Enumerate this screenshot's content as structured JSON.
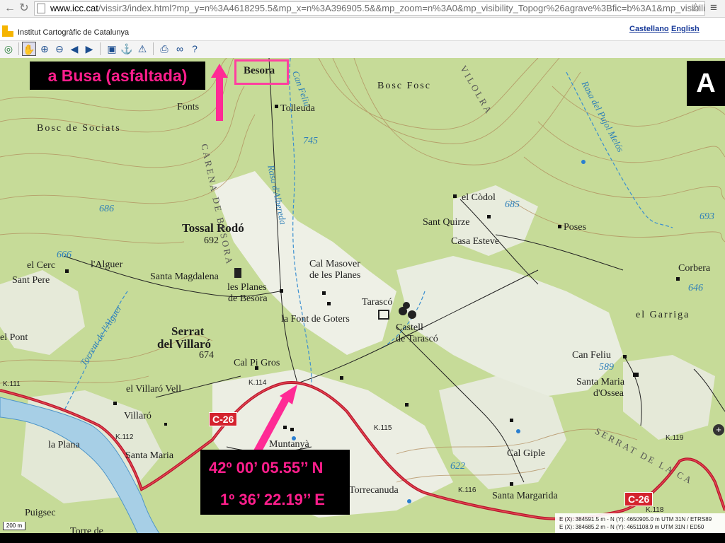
{
  "browser": {
    "url_host": "www.icc.cat",
    "url_path": "/vissir3/index.html?mp_y=n%3A4618295.5&mp_x=n%3A396905.5&&mp_zoom=n%3A0&mp_visibility_Topogr%26agrave%3Bfic=b%3A1&mp_visibility_Ort",
    "icons": [
      "back-icon",
      "reload-icon",
      "star-icon",
      "menu-icon"
    ]
  },
  "header": {
    "org_name": "Institut Cartogràfic de Catalunya",
    "lang_es": "Castellano",
    "lang_en": "English",
    "brand_color": "#f5b400"
  },
  "toolbar": {
    "tools": [
      "overview-icon",
      "pan-hand-icon",
      "zoom-in-icon",
      "zoom-out-icon",
      "previous-icon",
      "next-icon",
      "save-icon",
      "anchor-icon",
      "warning-icon",
      "print-icon",
      "link-icon",
      "help-icon"
    ]
  },
  "overlay": {
    "busa_label": "a Busa (asfaltada)",
    "coord_lat": "42º 00’ 05.55’’ N",
    "coord_lon": "1º 36’ 22.19’’ E",
    "letter": "A",
    "highlight_color": "#ff1e8c"
  },
  "map": {
    "places": {
      "besora": "Besora",
      "bosc_fosc": "Bosc Fosc",
      "fonts": "Fonts",
      "tolleuda": "Tolleuda",
      "bosc_sociats": "Bosc de Sociats",
      "el_codol": "el Còdol",
      "sant_quirze": "Sant Quirze",
      "casa_esteve": "Casa Esteve",
      "poses": "Poses",
      "tossal_rodo": "Tossal Rodó",
      "tossal_alt": "692",
      "el_cerc": "el Cerc",
      "alguer": "l'Alguer",
      "sant_pere": "Sant Pere",
      "santa_magdalena": "Santa Magdalena",
      "les_planes_1": "les Planes",
      "les_planes_2": "de Besora",
      "cal_masover_1": "Cal Masover",
      "cal_masover_2": "de les Planes",
      "tarasco": "Tarascó",
      "castell_1": "Castell",
      "castell_2": "de Tarascó",
      "font_goters": "la Font de Goters",
      "corbera": "Corbera",
      "el_garriga": "el Garriga",
      "serrat_1": "Serrat",
      "serrat_2": "del Villaró",
      "serrat_alt": "674",
      "el_pont": "el Pont",
      "cal_pi_gros": "Cal Pi Gros",
      "el_villaro_vell": "el Villaró Vell",
      "villaro": "Villaró",
      "can_feliu": "Can Feliu",
      "santa_maria_ossea_1": "Santa Maria",
      "santa_maria_ossea_2": "d'Ossea",
      "la_plana": "la Plana",
      "santa_maria": "Santa Maria",
      "muntanya": "Muntanyà",
      "cal_giple": "Cal Giple",
      "puigsec": "Puigsec",
      "torre_de": "Torre de",
      "torrecanuda": "Torrecanuda",
      "santa_margarida": "Santa Margarida"
    },
    "ridges": {
      "carena": "CARENA DE BESORA",
      "serrat_ca": "SERRAT DE LA CA",
      "vilolra": "VILOLRA"
    },
    "water": {
      "can_feliu": "Can Feliu",
      "rasa_albereda": "Rasa d'Albereda",
      "rasa_pujol": "Rasa del Pujol Melós",
      "torrent_alguer": "Torrent de l'Alguer"
    },
    "heights": {
      "h745": "745",
      "h686": "686",
      "h685": "685",
      "h693": "693",
      "h666": "666",
      "h646": "646",
      "h589": "589",
      "h622": "622"
    },
    "roads": {
      "c26_a": "C-26",
      "c26_b": "C-26",
      "k111": "K.111",
      "k114": "K.114",
      "k115": "K.115",
      "k112": "K.112",
      "k116": "K.116",
      "k118": "K.118",
      "k119": "K.119"
    },
    "utm_line1": "E (X): 384591.5 m - N (Y): 4650905.0 m UTM 31N / ETRS89",
    "utm_line2": "E (X): 384685.2 m - N (Y): 4651108.9 m UTM 31N / ED50",
    "scale": "200 m",
    "zoom_plus": "+"
  }
}
